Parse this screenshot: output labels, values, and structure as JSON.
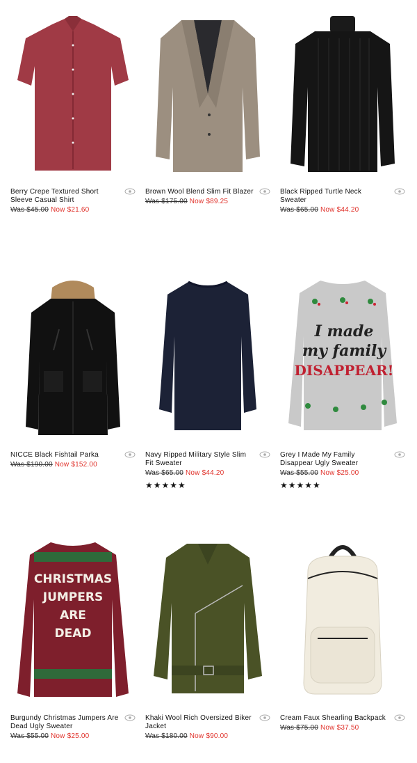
{
  "products": [
    {
      "name": "Berry Crepe Textured Short Sleeve Casual Shirt",
      "was": "Was $45.00",
      "now": "Now $21.60",
      "stars": ""
    },
    {
      "name": "Brown Wool Blend Slim Fit Blazer",
      "was": "Was $175.00",
      "now": "Now $89.25",
      "stars": ""
    },
    {
      "name": "Black Ripped Turtle Neck Sweater",
      "was": "Was $65.00",
      "now": "Now $44.20",
      "stars": ""
    },
    {
      "name": "NICCE Black Fishtail Parka",
      "was": "Was $190.00",
      "now": "Now $152.00",
      "stars": ""
    },
    {
      "name": "Navy Ripped Military Style Slim Fit Sweater",
      "was": "Was $65.00",
      "now": "Now $44.20",
      "stars": "★★★★★"
    },
    {
      "name": "Grey I Made My Family Disappear Ugly Sweater",
      "was": "Was $55.00",
      "now": "Now $25.00",
      "stars": "★★★★★"
    },
    {
      "name": "Burgundy Christmas Jumpers Are Dead Ugly Sweater",
      "was": "Was $55.00",
      "now": "Now $25.00",
      "stars": ""
    },
    {
      "name": "Khaki Wool Rich Oversized Biker Jacket",
      "was": "Was $180.00",
      "now": "Now $90.00",
      "stars": ""
    },
    {
      "name": "Cream Faux Shearling Backpack",
      "was": "Was $75.00",
      "now": "Now $37.50",
      "stars": ""
    }
  ],
  "sweater_text": {
    "grey_line1": "I made",
    "grey_line2": "my family",
    "grey_line3": "DISAPPEAR!",
    "burgundy_line1": "CHRISTMAS",
    "burgundy_line2": "JUMPERS",
    "burgundy_line3": "ARE",
    "burgundy_line4": "DEAD"
  },
  "colors": {
    "sale": "#e0322b",
    "text": "#111111"
  },
  "icons": {
    "quick_view": "eye-icon"
  }
}
